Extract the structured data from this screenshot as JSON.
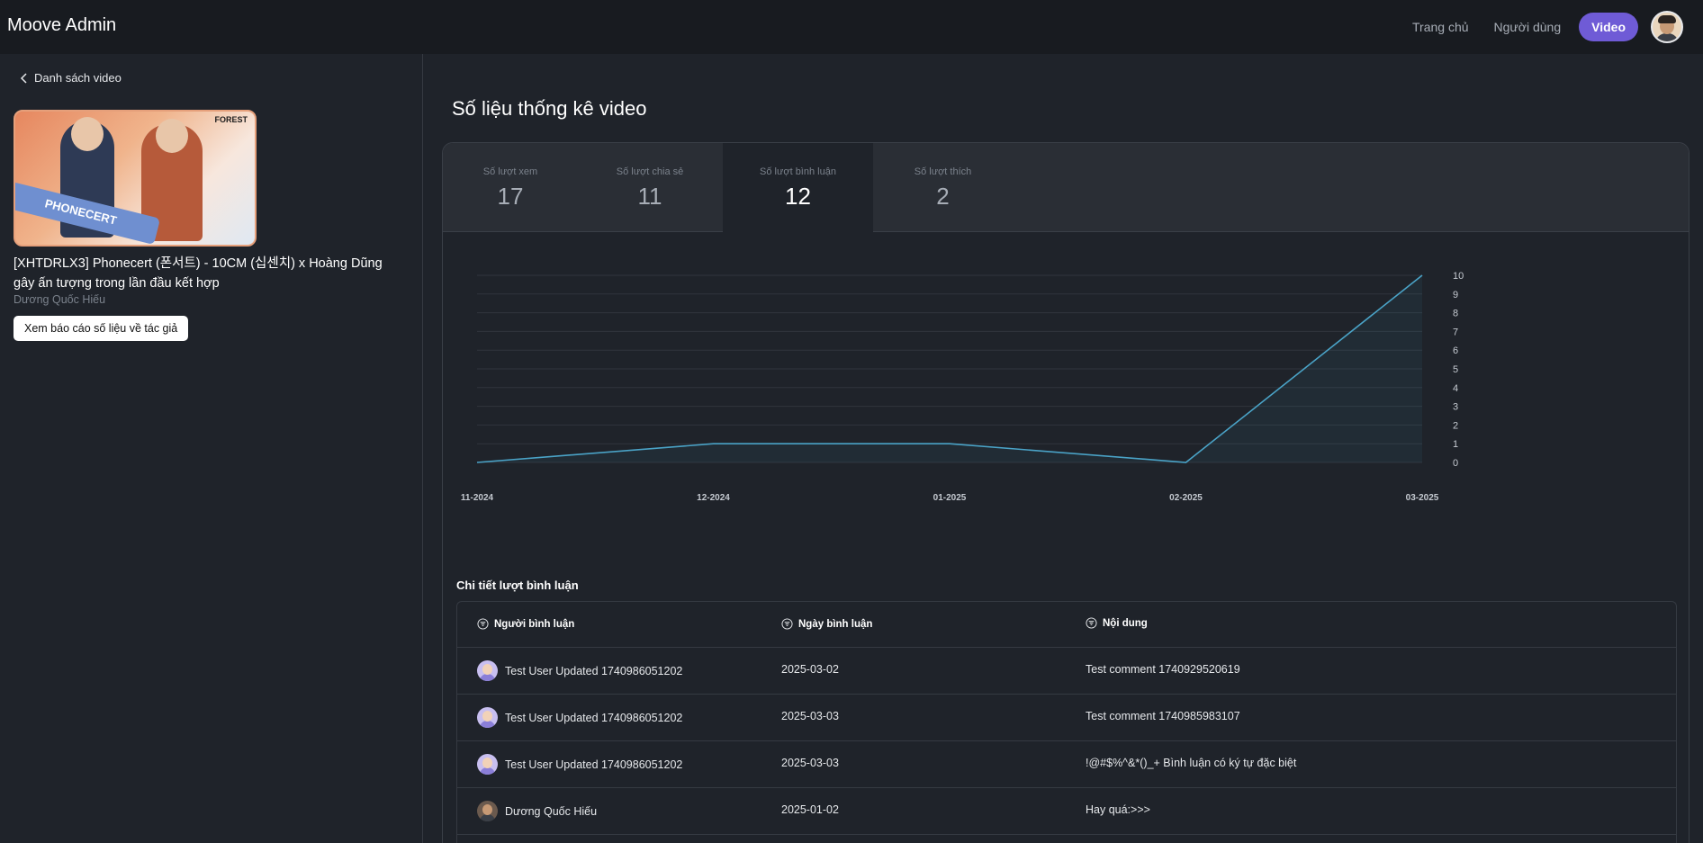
{
  "header": {
    "brand": "Moove Admin",
    "nav": [
      "Trang chủ",
      "Người dùng"
    ],
    "active_nav": "Video"
  },
  "sidebar": {
    "back_label": "Danh sách video",
    "thumbnail_text": "PHONECERT",
    "thumbnail_logo": "FOREST",
    "video_title": "[XHTDRLX3] Phonecert (폰서트) - 10CM (십센치) x Hoàng Dũng gây ấn tượng trong lần đầu kết hợp",
    "author": "Dương Quốc Hiếu",
    "report_button": "Xem báo cáo số liệu về tác giả"
  },
  "main": {
    "title": "Số liệu thống kê video",
    "tabs": [
      {
        "label": "Số lượt xem",
        "value": "17"
      },
      {
        "label": "Số lượt chia sẻ",
        "value": "11"
      },
      {
        "label": "Số lượt bình luận",
        "value": "12",
        "active": true
      },
      {
        "label": "Số lượt thích",
        "value": "2"
      }
    ],
    "comments_title": "Chi tiết lượt bình luận",
    "table": {
      "headers": [
        "Người bình luận",
        "Ngày bình luận",
        "Nội dung"
      ],
      "rows": [
        {
          "user": "Test User Updated 1740986051202",
          "date": "2025-03-02",
          "content": "Test comment 1740929520619",
          "avatar": "generic"
        },
        {
          "user": "Test User Updated 1740986051202",
          "date": "2025-03-03",
          "content": "Test comment 1740985983107",
          "avatar": "generic"
        },
        {
          "user": "Test User Updated 1740986051202",
          "date": "2025-03-03",
          "content": "!@#$%^&*()_+ Bình luận có ký tự đặc biệt",
          "avatar": "generic"
        },
        {
          "user": "Dương Quốc Hiếu",
          "date": "2025-01-02",
          "content": "Hay quá:>>>",
          "avatar": "real"
        }
      ]
    }
  },
  "chart_data": {
    "type": "area",
    "categories": [
      "11-2024",
      "12-2024",
      "01-2025",
      "02-2025",
      "03-2025"
    ],
    "values": [
      0,
      1,
      1,
      0,
      10
    ],
    "ylim": [
      0,
      10
    ],
    "yticks": [
      0,
      1,
      2,
      3,
      4,
      5,
      6,
      7,
      8,
      9,
      10
    ],
    "y_axis_side": "right",
    "grid": true,
    "line_color": "#4aa3c7",
    "title": "",
    "xlabel": "",
    "ylabel": ""
  },
  "colors": {
    "accent": "#6f5bd6",
    "background": "#1f232a",
    "header": "#181b20"
  }
}
